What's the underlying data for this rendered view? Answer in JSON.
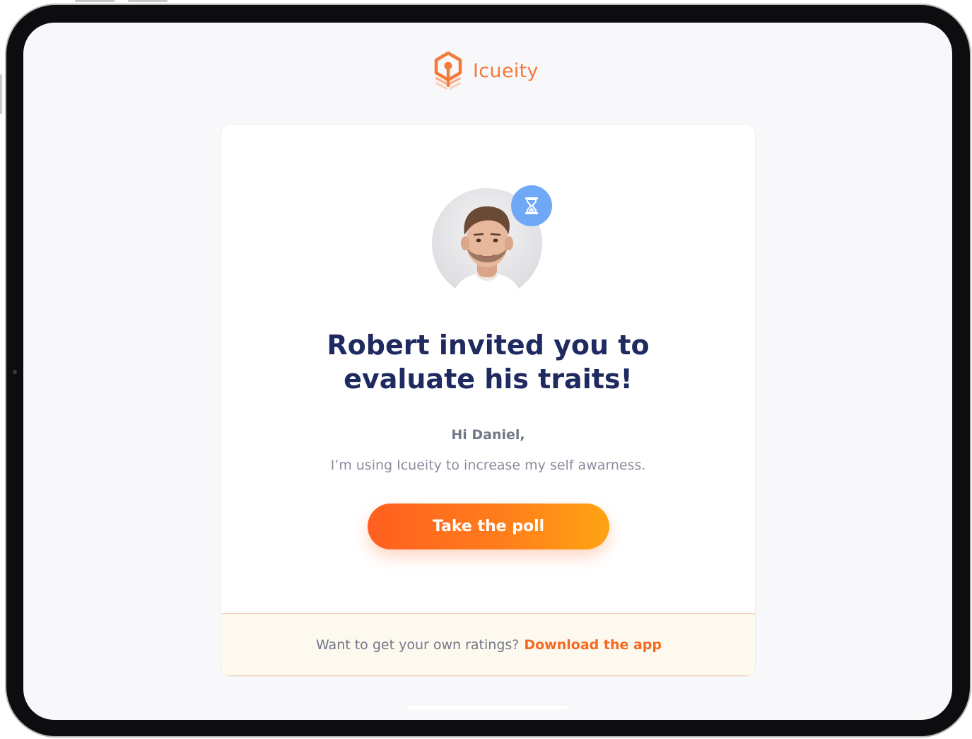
{
  "brand": {
    "name": "Icueity",
    "logo_icon": "icueity-logo-icon",
    "accent_color": "#f47a3a"
  },
  "invite": {
    "avatar_icon": "user-avatar",
    "status_icon": "hourglass-icon",
    "headline_line1": "Robert invited you to",
    "headline_line2": "evaluate his traits!",
    "greeting": "Hi Daniel,",
    "message": "I’m using Icueity to increase my self awarness.",
    "cta_label": "Take the poll"
  },
  "footer": {
    "text": "Want to get your own ratings?",
    "link_label": "Download the app"
  },
  "colors": {
    "heading": "#1f2a60",
    "body_text": "#8a8e9d",
    "button_start": "#ff5f1f",
    "button_end": "#ffa412",
    "badge": "#6fa8f7",
    "footer_bg": "#fdf9ef"
  }
}
